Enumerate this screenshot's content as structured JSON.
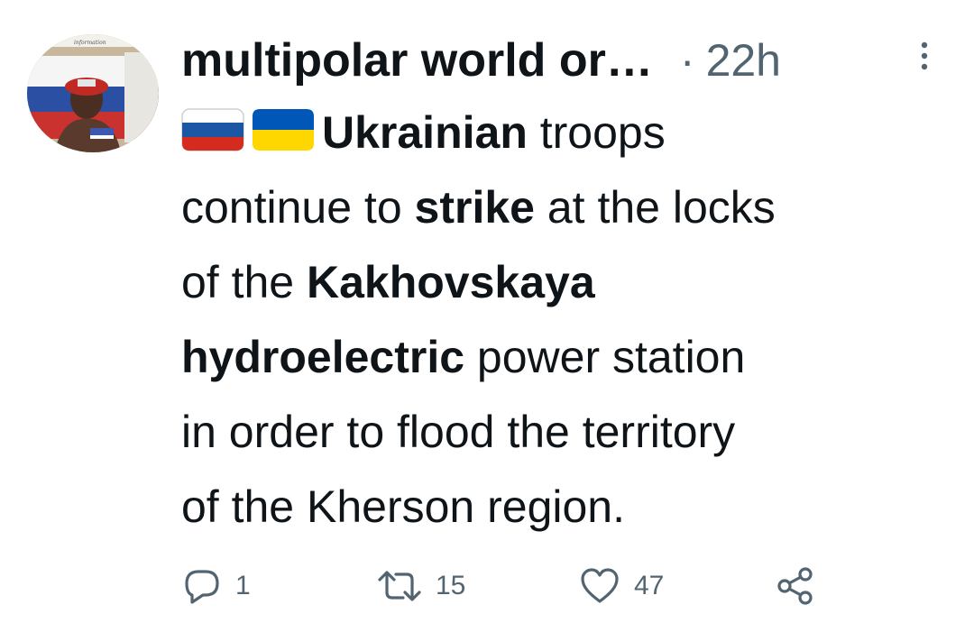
{
  "tweet": {
    "author": {
      "display_name": "multipolar world or…",
      "avatar_icon": "profile-photo",
      "avatar_caption": "information"
    },
    "separator": "·",
    "timestamp": "22h",
    "more_icon": "more-vertical-icon",
    "flags": [
      "russia-flag",
      "ukraine-flag"
    ],
    "text_lines": [
      [
        "Ukrainian",
        " troops"
      ],
      [
        "continue to ",
        "strike",
        " at the locks"
      ],
      [
        "of the ",
        "Kakhovskaya"
      ],
      [
        "hydroelectric",
        " power station"
      ],
      [
        "in order to flood the territory"
      ],
      [
        "of the Kherson region."
      ]
    ],
    "actions": {
      "reply": {
        "icon": "reply-icon",
        "count": "1"
      },
      "retweet": {
        "icon": "retweet-icon",
        "count": "15"
      },
      "like": {
        "icon": "heart-icon",
        "count": "47"
      },
      "share": {
        "icon": "share-icon"
      }
    },
    "colors": {
      "text": "#0f1419",
      "secondary": "#536471",
      "russia_white": "#ffffff",
      "russia_blue": "#1c57a5",
      "russia_red": "#d52b1e",
      "ukraine_blue": "#0057b7",
      "ukraine_yellow": "#ffd700"
    }
  }
}
